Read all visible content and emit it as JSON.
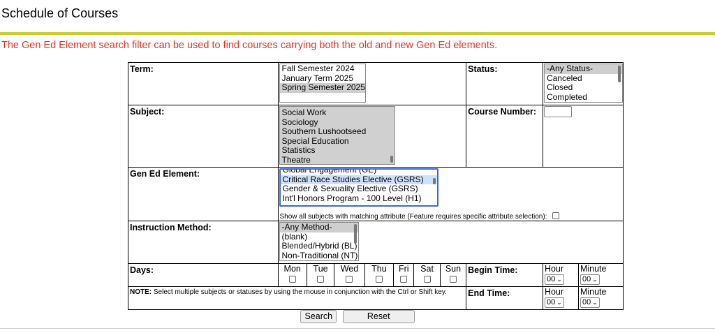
{
  "page": {
    "title": "Schedule of Courses",
    "notice": "The Gen Ed Element search filter can be used to find courses carrying both the old and new Gen Ed elements."
  },
  "colors": {
    "rule": "#cccc33",
    "notice": "#e8321e",
    "focus": "#3a6ad9"
  },
  "labels": {
    "term": "Term:",
    "status": "Status:",
    "subject": "Subject:",
    "course_number": "Course Number:",
    "gen_ed": "Gen Ed Element:",
    "instruction_method": "Instruction Method:",
    "days": "Days:",
    "begin_time": "Begin Time:",
    "end_time": "End Time:",
    "note_bold": "NOTE:",
    "note_text": " Select multiple subjects or statuses by using the mouse in conjunction with the Ctrl or Shift key."
  },
  "term_options": [
    "Fall Semester 2024",
    "January Term 2025",
    "Spring Semester 2025"
  ],
  "status_options": [
    "-Any Status-",
    "Canceled",
    "Closed",
    "Completed"
  ],
  "subject_options": [
    "Social Work",
    "Sociology",
    "Southern Lushootseed",
    "Special Education",
    "Statistics",
    "Theatre"
  ],
  "gen_ed_options": [
    "Global Engagement (GE)",
    "Critical Race Studies Elective (GSRS)",
    "Gender & Sexuality Elective (GSRS)",
    "Int'l Honors Program - 100 Level (H1)"
  ],
  "show_all_subjects": "Show all subjects with matching attribute (Feature requires specific attribute selection):",
  "instruction_options": [
    "-Any Method-",
    "(blank)",
    "Blended/Hybrid (BL)",
    "Non-Traditional (NT)"
  ],
  "days": [
    "Mon",
    "Tue",
    "Wed",
    "Thu",
    "Fri",
    "Sat",
    "Sun"
  ],
  "time": {
    "hour_label": "Hour",
    "minute_label": "Minute",
    "hour_value": "00",
    "minute_value": "00"
  },
  "buttons": {
    "search": "Search",
    "reset": "Reset"
  }
}
